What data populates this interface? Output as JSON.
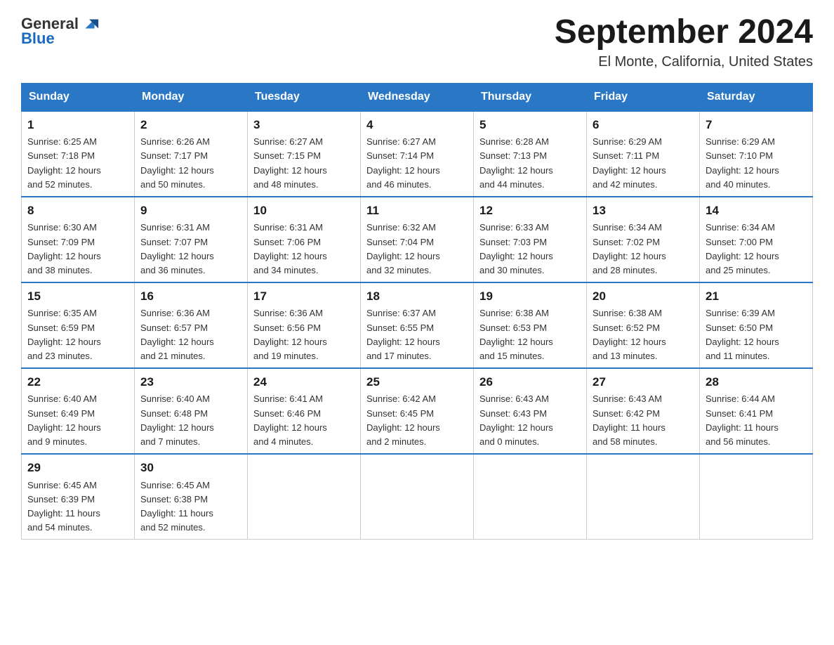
{
  "header": {
    "logo_general": "General",
    "logo_blue": "Blue",
    "title": "September 2024",
    "subtitle": "El Monte, California, United States"
  },
  "weekdays": [
    "Sunday",
    "Monday",
    "Tuesday",
    "Wednesday",
    "Thursday",
    "Friday",
    "Saturday"
  ],
  "weeks": [
    [
      {
        "day": "1",
        "info": "Sunrise: 6:25 AM\nSunset: 7:18 PM\nDaylight: 12 hours\nand 52 minutes."
      },
      {
        "day": "2",
        "info": "Sunrise: 6:26 AM\nSunset: 7:17 PM\nDaylight: 12 hours\nand 50 minutes."
      },
      {
        "day": "3",
        "info": "Sunrise: 6:27 AM\nSunset: 7:15 PM\nDaylight: 12 hours\nand 48 minutes."
      },
      {
        "day": "4",
        "info": "Sunrise: 6:27 AM\nSunset: 7:14 PM\nDaylight: 12 hours\nand 46 minutes."
      },
      {
        "day": "5",
        "info": "Sunrise: 6:28 AM\nSunset: 7:13 PM\nDaylight: 12 hours\nand 44 minutes."
      },
      {
        "day": "6",
        "info": "Sunrise: 6:29 AM\nSunset: 7:11 PM\nDaylight: 12 hours\nand 42 minutes."
      },
      {
        "day": "7",
        "info": "Sunrise: 6:29 AM\nSunset: 7:10 PM\nDaylight: 12 hours\nand 40 minutes."
      }
    ],
    [
      {
        "day": "8",
        "info": "Sunrise: 6:30 AM\nSunset: 7:09 PM\nDaylight: 12 hours\nand 38 minutes."
      },
      {
        "day": "9",
        "info": "Sunrise: 6:31 AM\nSunset: 7:07 PM\nDaylight: 12 hours\nand 36 minutes."
      },
      {
        "day": "10",
        "info": "Sunrise: 6:31 AM\nSunset: 7:06 PM\nDaylight: 12 hours\nand 34 minutes."
      },
      {
        "day": "11",
        "info": "Sunrise: 6:32 AM\nSunset: 7:04 PM\nDaylight: 12 hours\nand 32 minutes."
      },
      {
        "day": "12",
        "info": "Sunrise: 6:33 AM\nSunset: 7:03 PM\nDaylight: 12 hours\nand 30 minutes."
      },
      {
        "day": "13",
        "info": "Sunrise: 6:34 AM\nSunset: 7:02 PM\nDaylight: 12 hours\nand 28 minutes."
      },
      {
        "day": "14",
        "info": "Sunrise: 6:34 AM\nSunset: 7:00 PM\nDaylight: 12 hours\nand 25 minutes."
      }
    ],
    [
      {
        "day": "15",
        "info": "Sunrise: 6:35 AM\nSunset: 6:59 PM\nDaylight: 12 hours\nand 23 minutes."
      },
      {
        "day": "16",
        "info": "Sunrise: 6:36 AM\nSunset: 6:57 PM\nDaylight: 12 hours\nand 21 minutes."
      },
      {
        "day": "17",
        "info": "Sunrise: 6:36 AM\nSunset: 6:56 PM\nDaylight: 12 hours\nand 19 minutes."
      },
      {
        "day": "18",
        "info": "Sunrise: 6:37 AM\nSunset: 6:55 PM\nDaylight: 12 hours\nand 17 minutes."
      },
      {
        "day": "19",
        "info": "Sunrise: 6:38 AM\nSunset: 6:53 PM\nDaylight: 12 hours\nand 15 minutes."
      },
      {
        "day": "20",
        "info": "Sunrise: 6:38 AM\nSunset: 6:52 PM\nDaylight: 12 hours\nand 13 minutes."
      },
      {
        "day": "21",
        "info": "Sunrise: 6:39 AM\nSunset: 6:50 PM\nDaylight: 12 hours\nand 11 minutes."
      }
    ],
    [
      {
        "day": "22",
        "info": "Sunrise: 6:40 AM\nSunset: 6:49 PM\nDaylight: 12 hours\nand 9 minutes."
      },
      {
        "day": "23",
        "info": "Sunrise: 6:40 AM\nSunset: 6:48 PM\nDaylight: 12 hours\nand 7 minutes."
      },
      {
        "day": "24",
        "info": "Sunrise: 6:41 AM\nSunset: 6:46 PM\nDaylight: 12 hours\nand 4 minutes."
      },
      {
        "day": "25",
        "info": "Sunrise: 6:42 AM\nSunset: 6:45 PM\nDaylight: 12 hours\nand 2 minutes."
      },
      {
        "day": "26",
        "info": "Sunrise: 6:43 AM\nSunset: 6:43 PM\nDaylight: 12 hours\nand 0 minutes."
      },
      {
        "day": "27",
        "info": "Sunrise: 6:43 AM\nSunset: 6:42 PM\nDaylight: 11 hours\nand 58 minutes."
      },
      {
        "day": "28",
        "info": "Sunrise: 6:44 AM\nSunset: 6:41 PM\nDaylight: 11 hours\nand 56 minutes."
      }
    ],
    [
      {
        "day": "29",
        "info": "Sunrise: 6:45 AM\nSunset: 6:39 PM\nDaylight: 11 hours\nand 54 minutes."
      },
      {
        "day": "30",
        "info": "Sunrise: 6:45 AM\nSunset: 6:38 PM\nDaylight: 11 hours\nand 52 minutes."
      },
      {
        "day": "",
        "info": ""
      },
      {
        "day": "",
        "info": ""
      },
      {
        "day": "",
        "info": ""
      },
      {
        "day": "",
        "info": ""
      },
      {
        "day": "",
        "info": ""
      }
    ]
  ]
}
